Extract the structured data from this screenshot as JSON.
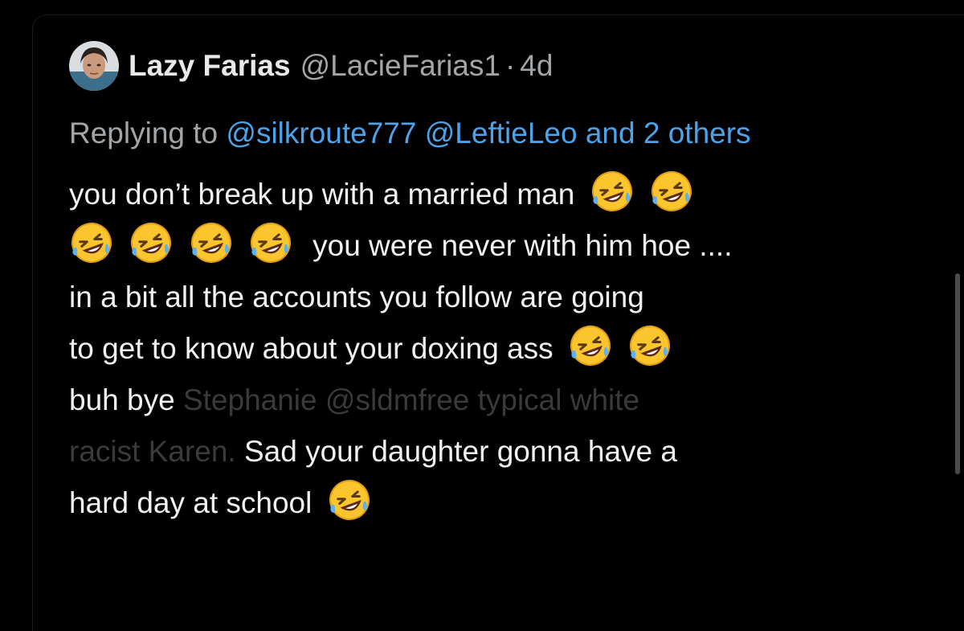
{
  "tweet": {
    "display_name": "Lazy Farias",
    "handle": "@LacieFarias1",
    "separator": "·",
    "time": "4d",
    "replying_to_label": "Replying to",
    "mention_1": "@silkroute777",
    "mention_2": "@LeftieLeo",
    "others_text": "and 2 others",
    "body": {
      "line1": "you don’t break up with a married man",
      "line2": "you were never with him hoe ....",
      "line3": "in a bit all the accounts you follow are going",
      "line4": "to get to know about your doxing ass",
      "line5_visible": "buh bye ",
      "line5_faded": "Stephanie @sldmfree typical white",
      "line6_faded": "racist Karen.",
      "line6_visible": " Sad your daughter gonna have a",
      "line7": "hard day at school"
    },
    "emoji_icon": "rolling-on-floor-laughing-icon",
    "accent_color": "#4da3ea"
  }
}
